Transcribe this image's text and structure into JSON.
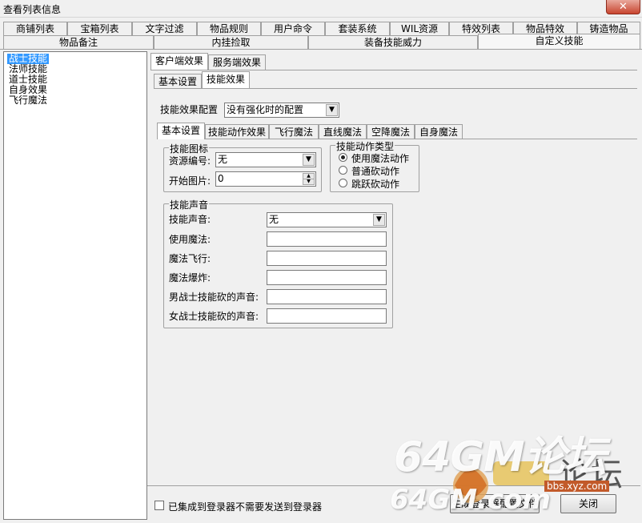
{
  "window": {
    "title": "查看列表信息",
    "close_glyph": "✕"
  },
  "tabs_row1": [
    "商铺列表",
    "宝箱列表",
    "文字过滤",
    "物品规则",
    "用户命令",
    "套装系统",
    "WIL资源",
    "特效列表",
    "物品特效",
    "铸造物品"
  ],
  "tabs_row2": [
    "物品备注",
    "内挂捡取",
    "装备技能威力",
    "自定义技能"
  ],
  "left_list": [
    "战士技能",
    "法师技能",
    "道士技能",
    "自身效果",
    "飞行魔法"
  ],
  "effect_tabs": [
    "客户端效果",
    "服务端效果"
  ],
  "skill_tabs": [
    "基本设置",
    "技能效果"
  ],
  "config": {
    "label": "技能效果配置",
    "value": "没有强化时的配置"
  },
  "action_tabs": [
    "基本设置",
    "技能动作效果",
    "飞行魔法",
    "直线魔法",
    "空降魔法",
    "自身魔法"
  ],
  "icon_group": {
    "title": "技能图标",
    "resource_label": "资源编号:",
    "resource_value": "无",
    "start_label": "开始图片:",
    "start_value": "0"
  },
  "action_type_group": {
    "title": "技能动作类型",
    "options": [
      "使用魔法动作",
      "普通砍动作",
      "跳跃砍动作"
    ],
    "selected_index": 0
  },
  "sound_group": {
    "title": "技能声音",
    "rows": [
      {
        "label": "技能声音:",
        "value": "无"
      },
      {
        "label": "使用魔法:",
        "value": ""
      },
      {
        "label": "魔法飞行:",
        "value": ""
      },
      {
        "label": "魔法爆炸:",
        "value": ""
      },
      {
        "label": "男战士技能砍的声音:",
        "value": ""
      },
      {
        "label": "女战士技能砍的声音:",
        "value": ""
      }
    ]
  },
  "footer": {
    "checkbox_label": "已集成到登录器不需要发送到登录器",
    "save_button": "生成登录器配置文件",
    "cancel_button": "关闭"
  },
  "watermark": {
    "main": "64GM论坛",
    "sub": "64GM.com",
    "cn": "论坛",
    "small": "bbs.xyz.com"
  },
  "colors": {
    "selection": "#3399ff",
    "close_button": "#c8452f",
    "window_bg": "#f0f0f0"
  }
}
